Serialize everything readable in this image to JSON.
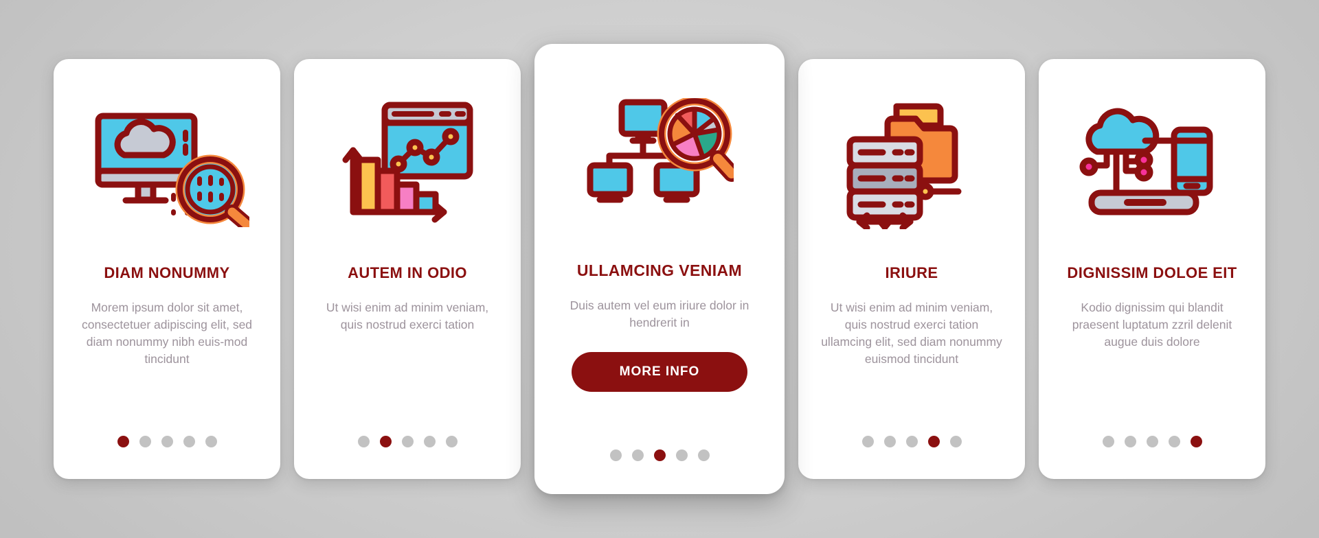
{
  "theme": {
    "accent_red": "#8B1010",
    "body_text": "#9d939c",
    "dot_inactive": "#c2c2c2",
    "card_bg": "#ffffff",
    "page_bg": "#c9c9c9",
    "icon_cyan": "#4FC8E8",
    "icon_orange": "#F5883C",
    "icon_yellow": "#FCC24F",
    "icon_pink": "#F77FC4",
    "icon_coral": "#F15B5B",
    "icon_grey": "#C6CAD4",
    "icon_teal": "#2AA88A"
  },
  "cards": [
    {
      "id": "diam-nonummy",
      "featured": false,
      "icon": "monitor-cloud-magnifier-icon",
      "title": "DIAM NONUMMY",
      "body": "Morem ipsum dolor sit amet, consectetuer adipiscing elit, sed diam nonummy nibh euis-mod tincidunt",
      "button": null,
      "dots_total": 5,
      "dot_active": 0
    },
    {
      "id": "autem-in-odio",
      "featured": false,
      "icon": "bar-line-chart-browser-icon",
      "title": "AUTEM IN ODIO",
      "body": "Ut wisi enim ad minim veniam, quis nostrud exerci tation",
      "button": null,
      "dots_total": 5,
      "dot_active": 1
    },
    {
      "id": "ullamcing-veniam",
      "featured": true,
      "icon": "network-pie-magnifier-icon",
      "title": "ULLAMCING VENIAM",
      "body": "Duis autem vel eum iriure dolor in hendrerit in",
      "button": "MORE INFO",
      "dots_total": 5,
      "dot_active": 2
    },
    {
      "id": "iriure",
      "featured": false,
      "icon": "server-folder-transfer-icon",
      "title": "IRIURE",
      "body": "Ut wisi enim ad minim veniam, quis nostrud exerci tation ullamcing elit, sed diam nonummy euismod tincidunt",
      "button": null,
      "dots_total": 5,
      "dot_active": 3
    },
    {
      "id": "dignissim-doloe-eit",
      "featured": false,
      "icon": "cloud-mobile-laptop-icon",
      "title": "DIGNISSIM DOLOE EIT",
      "body": "Kodio dignissim qui blandit praesent luptatum zzril delenit augue duis dolore",
      "button": null,
      "dots_total": 5,
      "dot_active": 4
    }
  ]
}
